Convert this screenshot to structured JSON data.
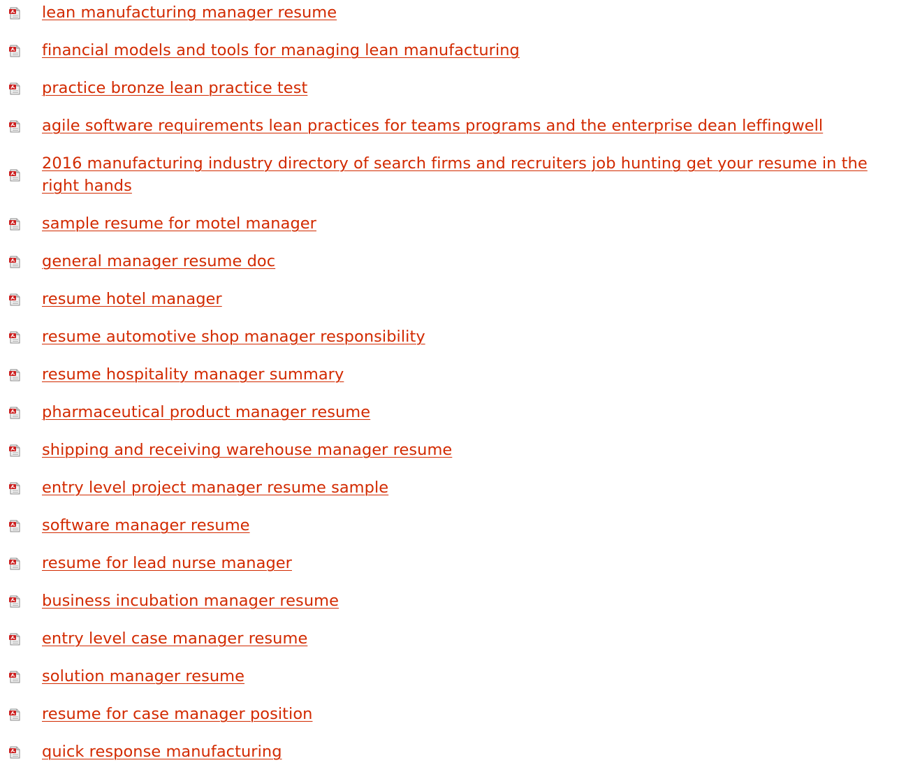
{
  "links": [
    {
      "label": "lean manufacturing manager resume",
      "icon": "pdf-file-icon"
    },
    {
      "label": "financial models and tools for managing lean manufacturing",
      "icon": "pdf-file-icon"
    },
    {
      "label": "practice bronze lean practice test",
      "icon": "pdf-file-icon"
    },
    {
      "label": "agile software requirements lean practices for teams programs and the enterprise dean leffingwell",
      "icon": "pdf-file-icon"
    },
    {
      "label": "2016 manufacturing industry directory of search firms and recruiters job hunting get your resume in the right hands",
      "icon": "pdf-file-icon"
    },
    {
      "label": "sample resume for motel manager",
      "icon": "pdf-file-icon"
    },
    {
      "label": "general manager resume doc",
      "icon": "pdf-file-icon"
    },
    {
      "label": "resume hotel manager",
      "icon": "pdf-file-icon"
    },
    {
      "label": "resume automotive shop manager responsibility",
      "icon": "pdf-file-icon"
    },
    {
      "label": "resume hospitality manager summary",
      "icon": "pdf-file-icon"
    },
    {
      "label": "pharmaceutical product manager resume",
      "icon": "pdf-file-icon"
    },
    {
      "label": "shipping and receiving warehouse manager resume",
      "icon": "pdf-file-icon"
    },
    {
      "label": "entry level project manager resume sample",
      "icon": "pdf-file-icon"
    },
    {
      "label": "software manager resume",
      "icon": "pdf-file-icon"
    },
    {
      "label": "resume for lead nurse manager",
      "icon": "pdf-file-icon"
    },
    {
      "label": "business incubation manager resume",
      "icon": "pdf-file-icon"
    },
    {
      "label": "entry level case manager resume",
      "icon": "pdf-file-icon"
    },
    {
      "label": "solution manager resume",
      "icon": "pdf-file-icon"
    },
    {
      "label": "resume for case manager position",
      "icon": "pdf-file-icon"
    },
    {
      "label": "quick response manufacturing",
      "icon": "pdf-file-icon"
    }
  ],
  "colors": {
    "link": "#d22a00",
    "icon_red": "#cc1f1f",
    "icon_page": "#f2f2f2"
  }
}
